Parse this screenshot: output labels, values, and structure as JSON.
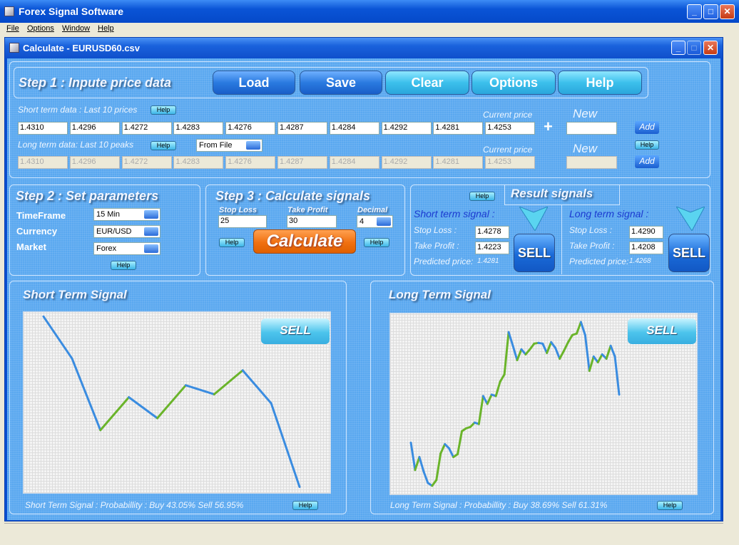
{
  "app": {
    "title": "Forex Signal Software",
    "menu": [
      "File",
      "Options",
      "Window",
      "Help"
    ]
  },
  "child": {
    "title": "Calculate - EURUSD60.csv"
  },
  "step1": {
    "title": "Step 1 : Inpute price data",
    "buttons": [
      "Load",
      "Save",
      "Clear",
      "Options",
      "Help"
    ],
    "short_label": "Short term data : Last 10 prices",
    "long_label": "Long term data: Last 10 peaks",
    "short_prices": [
      "1.4310",
      "1.4296",
      "1.4272",
      "1.4283",
      "1.4276",
      "1.4287",
      "1.4284",
      "1.4292",
      "1.4281",
      "1.4253"
    ],
    "long_prices": [
      "1.4310",
      "1.4296",
      "1.4272",
      "1.4283",
      "1.4276",
      "1.4287",
      "1.4284",
      "1.4292",
      "1.4281",
      "1.4253"
    ],
    "current_price_label": "Current price",
    "new_label": "New",
    "add_label": "Add",
    "help_label": "Help",
    "plus": "+",
    "source": "From File",
    "new_short": "",
    "new_long": ""
  },
  "step2": {
    "title": "Step 2 : Set parameters",
    "timeframe_label": "TimeFrame",
    "timeframe": "15 Min",
    "currency_label": "Currency",
    "currency": "EUR/USD",
    "market_label": "Market",
    "market": "Forex"
  },
  "step3": {
    "title": "Step 3 : Calculate signals",
    "stop_loss_label": "Stop Loss",
    "stop_loss": "25",
    "take_profit_label": "Take Profit",
    "take_profit": "30",
    "decimal_label": "Decimal",
    "decimal": "4",
    "calculate": "Calculate"
  },
  "results": {
    "title": "Result signals",
    "short": {
      "title": "Short term signal :",
      "sl_label": "Stop Loss :",
      "sl": "1.4278",
      "tp_label": "Take Profit :",
      "tp": "1.4223",
      "pred_label": "Predicted price:",
      "pred": "1.4281",
      "signal": "SELL"
    },
    "long": {
      "title": "Long term signal :",
      "sl_label": "Stop Loss :",
      "sl": "1.4290",
      "tp_label": "Take Profit :",
      "tp": "1.4208",
      "pred_label": "Predicted price:",
      "pred": "1.4268",
      "signal": "SELL"
    }
  },
  "colors": {
    "up": "#6ab42a",
    "down": "#3a8ce0"
  },
  "chart_data": [
    {
      "type": "line",
      "title": "Short Term Signal",
      "badge": "SELL",
      "probability": "Short Term Signal : Probabillity : Buy 43.05% Sell 56.95%",
      "values": [
        1.431,
        1.4296,
        1.4272,
        1.4283,
        1.4276,
        1.4287,
        1.4284,
        1.4292,
        1.4281,
        1.4253
      ],
      "ylim": [
        1.42505,
        1.43115
      ]
    },
    {
      "type": "line",
      "title": "Long Term Signal",
      "badge": "SELL",
      "probability": "Long Term Signal : Probabillity :  Buy 38.69% Sell 61.31%",
      "values": [
        74,
        36,
        54,
        34,
        18,
        14,
        22,
        59,
        72,
        66,
        54,
        58,
        90,
        94,
        96,
        102,
        100,
        139,
        128,
        141,
        139,
        159,
        169,
        228,
        209,
        189,
        204,
        197,
        204,
        212,
        213,
        212,
        199,
        214,
        206,
        191,
        202,
        214,
        224,
        226,
        242,
        224,
        174,
        194,
        186,
        197,
        191,
        209,
        194,
        141
      ],
      "ylim": [
        0,
        254
      ]
    }
  ]
}
